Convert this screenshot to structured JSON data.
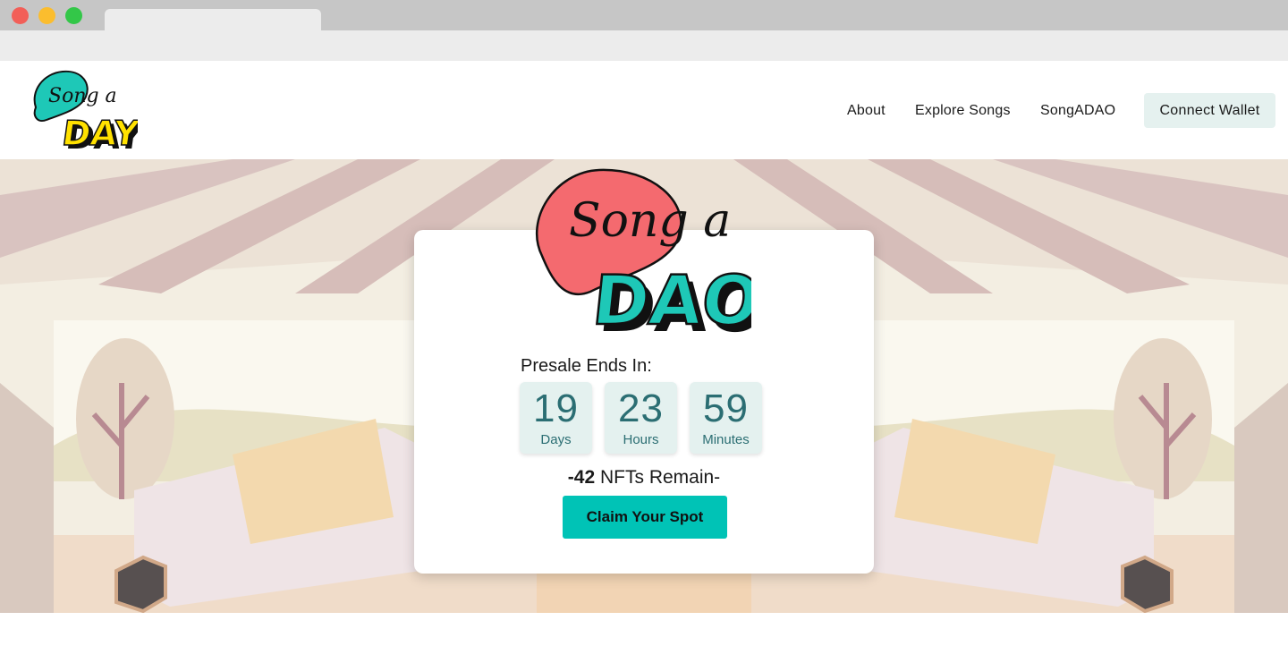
{
  "browser": {
    "tab_title": ""
  },
  "header": {
    "logo_text": {
      "line1": "Song a",
      "line2": "DAY"
    },
    "nav": [
      {
        "label": "About"
      },
      {
        "label": "Explore Songs"
      },
      {
        "label": "SongADAO"
      }
    ],
    "connect_wallet_label": "Connect Wallet"
  },
  "presale": {
    "logo_text": {
      "line1": "Song a",
      "line2": "DAO"
    },
    "label": "Presale Ends In:",
    "countdown": {
      "days": {
        "value": "19",
        "unit": "Days"
      },
      "hours": {
        "value": "23",
        "unit": "Hours"
      },
      "minutes": {
        "value": "59",
        "unit": "Minutes"
      }
    },
    "remain_prefix": "-",
    "remain_count": "42",
    "remain_suffix": " NFTs Remain-",
    "claim_label": "Claim Your Spot"
  },
  "colors": {
    "accent_teal": "#00c3b6",
    "countdown_text": "#2b6e73",
    "logo_pink": "#f46a6f",
    "logo_teal": "#1ec8b7",
    "logo_yellow": "#ffe100",
    "connect_bg": "#e5f1ef"
  }
}
